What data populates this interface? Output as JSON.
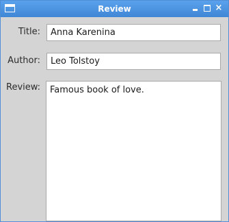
{
  "window": {
    "title": "Review",
    "close_glyph": "×"
  },
  "form": {
    "title_label": "Title:",
    "title_value": "Anna Karenina",
    "author_label": "Author:",
    "author_value": "Leo Tolstoy",
    "review_label": "Review:",
    "review_value": "Famous book of love."
  },
  "icons": {
    "app": "window-icon",
    "minimize": "minimize-icon",
    "maximize": "maximize-icon",
    "close": "close-icon"
  },
  "colors": {
    "titlebar": "#4a94e2",
    "window_bg": "#d4d4d4",
    "field_bg": "#ffffff"
  }
}
